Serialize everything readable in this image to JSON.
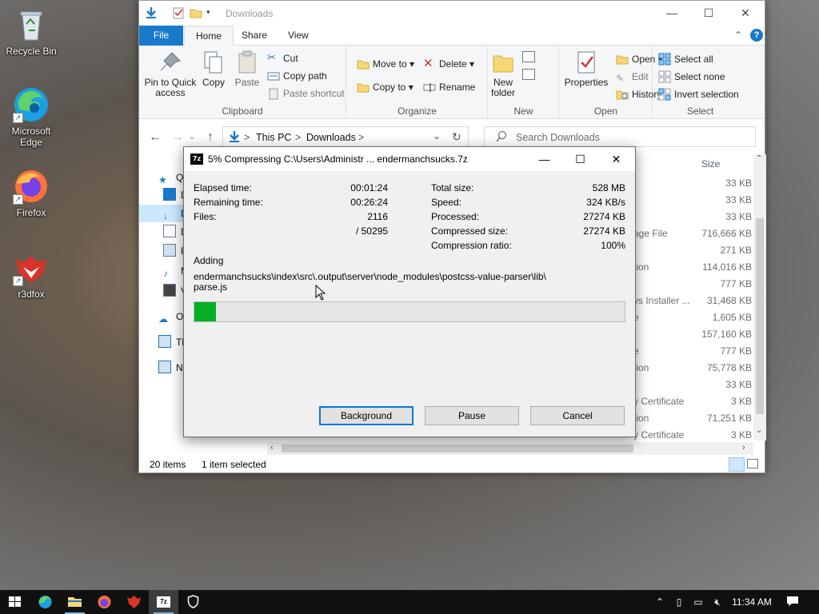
{
  "desktop": {
    "icons": [
      {
        "label": "Recycle Bin",
        "icon": "recycle-bin-icon"
      },
      {
        "label": "Microsoft Edge",
        "icon": "edge-icon"
      },
      {
        "label": "Firefox",
        "icon": "firefox-icon"
      },
      {
        "label": "r3dfox",
        "icon": "r3dfox-icon"
      }
    ]
  },
  "explorer": {
    "title": "Downloads",
    "tabs": {
      "file": "File",
      "home": "Home",
      "share": "Share",
      "view": "View"
    },
    "ribbon": {
      "pin_label": "Pin to Quick access",
      "copy_label": "Copy",
      "paste_label": "Paste",
      "cut_label": "Cut",
      "copy_path_label": "Copy path",
      "paste_shortcut_label": "Paste shortcut",
      "clipboard_group": "Clipboard",
      "move_to_label": "Move to",
      "copy_to_label": "Copy to",
      "delete_label": "Delete",
      "rename_label": "Rename",
      "organize_group": "Organize",
      "new_folder_label": "New folder",
      "new_group": "New",
      "properties_label": "Properties",
      "open_label": "Open",
      "edit_label": "Edit",
      "history_label": "History",
      "open_group": "Open",
      "select_all_label": "Select all",
      "select_none_label": "Select none",
      "invert_selection_label": "Invert selection",
      "select_group": "Select"
    },
    "address": {
      "this_pc": "This PC",
      "downloads": "Downloads",
      "sep": ">"
    },
    "search": {
      "placeholder": "Search Downloads"
    },
    "nav": {
      "quick": "Q",
      "desktop": "D",
      "downloads": "D",
      "documents": "D",
      "pictures": "P",
      "music": "M",
      "videos": "V",
      "onedrive": "O",
      "thispc": "Th",
      "network": "Ne"
    },
    "list": {
      "size_header": "Size",
      "rows": [
        {
          "type": "",
          "size": "33 KB"
        },
        {
          "type": "",
          "size": "33 KB"
        },
        {
          "type": "",
          "size": "33 KB"
        },
        {
          "type": "age File",
          "size": "716,666 KB"
        },
        {
          "type": "",
          "size": "271 KB"
        },
        {
          "type": "tion",
          "size": "114,016 KB"
        },
        {
          "type": "",
          "size": "777 KB"
        },
        {
          "type": "vs Installer ...",
          "size": "31,468 KB"
        },
        {
          "type": "e",
          "size": "1,605 KB"
        },
        {
          "type": "",
          "size": "157,160 KB"
        },
        {
          "type": "e",
          "size": "777 KB"
        },
        {
          "type": "tion",
          "size": "75,778 KB"
        },
        {
          "type": "",
          "size": "33 KB"
        },
        {
          "type": "y Certificate",
          "size": "3 KB"
        },
        {
          "type": "tion",
          "size": "71,251 KB"
        },
        {
          "type": "y Certificate",
          "size": "3 KB"
        }
      ]
    },
    "status": {
      "items": "20 items",
      "selected": "1 item selected"
    }
  },
  "dialog": {
    "title": "5% Compressing C:\\Users\\Administr ... endermanchsucks.7z",
    "elapsed_label": "Elapsed time:",
    "elapsed_value": "00:01:24",
    "remaining_label": "Remaining time:",
    "remaining_value": "00:26:24",
    "files_label": "Files:",
    "files_value": "2116",
    "files_total": "/ 50295",
    "total_size_label": "Total size:",
    "total_size_value": "528 MB",
    "speed_label": "Speed:",
    "speed_value": "324 KB/s",
    "processed_label": "Processed:",
    "processed_value": "27274 KB",
    "compressed_label": "Compressed size:",
    "compressed_value": "27274 KB",
    "ratio_label": "Compression ratio:",
    "ratio_value": "100%",
    "action": "Adding",
    "path_line1": "endermanchsucks\\index\\src\\.output\\server\\node_modules\\postcss-value-parser\\lib\\",
    "path_line2": "parse.js",
    "progress_percent": 5,
    "buttons": {
      "background": "Background",
      "pause": "Pause",
      "cancel": "Cancel"
    }
  },
  "taskbar": {
    "clock": "11:34 AM",
    "pinned": [
      "start-icon",
      "edge-icon",
      "file-explorer-icon",
      "firefox-icon",
      "r3dfox-icon",
      "7zip-icon",
      "security-icon"
    ]
  },
  "colors": {
    "accent": "#1979ca",
    "progress": "#06b025",
    "selection": "#cce8ff"
  }
}
